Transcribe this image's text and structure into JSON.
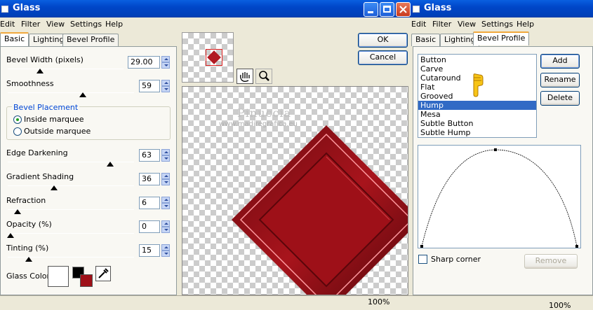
{
  "window": {
    "title": "Glass",
    "menu": [
      "Edit",
      "Filter",
      "View",
      "Settings",
      "Help"
    ],
    "tabs": [
      "Basic",
      "Lighting",
      "Bevel Profile"
    ]
  },
  "basic": {
    "bevel_width_label": "Bevel Width (pixels)",
    "bevel_width_value": "29.00",
    "smoothness_label": "Smoothness",
    "smoothness_value": "59",
    "placement_group_label": "Bevel Placement",
    "inside_marquee_label": "Inside marquee",
    "outside_marquee_label": "Outside marquee",
    "edge_darkening_label": "Edge Darkening",
    "edge_darkening_value": "63",
    "gradient_shading_label": "Gradient Shading",
    "gradient_shading_value": "36",
    "refraction_label": "Refraction",
    "refraction_value": "6",
    "opacity_label": "Opacity (%)",
    "opacity_value": "0",
    "tinting_label": "Tinting (%)",
    "tinting_value": "15",
    "glass_color_label": "Glass Color"
  },
  "sliders": {
    "bevel_width": 0.29,
    "smoothness": 0.59,
    "edge_darkening": 0.63,
    "gradient_shading": 0.36,
    "refraction": 0.06,
    "opacity": 0.0,
    "tinting": 0.15
  },
  "buttons": {
    "ok": "OK",
    "cancel": "Cancel",
    "add": "Add",
    "rename": "Rename",
    "delete": "Delete",
    "remove": "Remove"
  },
  "preview": {
    "watermark_line1": "Pinuccia",
    "watermark_line2": "www.madiregrafica.eu",
    "zoom_left": "100%",
    "zoom_right": "100%"
  },
  "bevel_profile": {
    "items": [
      "Button",
      "Carve",
      "Cutaround",
      "Flat",
      "Grooved",
      "Hump",
      "Mesa",
      "Subtle Button",
      "Subtle Hump"
    ],
    "selected": "Hump",
    "sharp_corner_label": "Sharp corner"
  },
  "colors": {
    "glass_red": "#9e1018",
    "selection_blue": "#316ac5",
    "titlebar_blue": "#0046c8"
  }
}
